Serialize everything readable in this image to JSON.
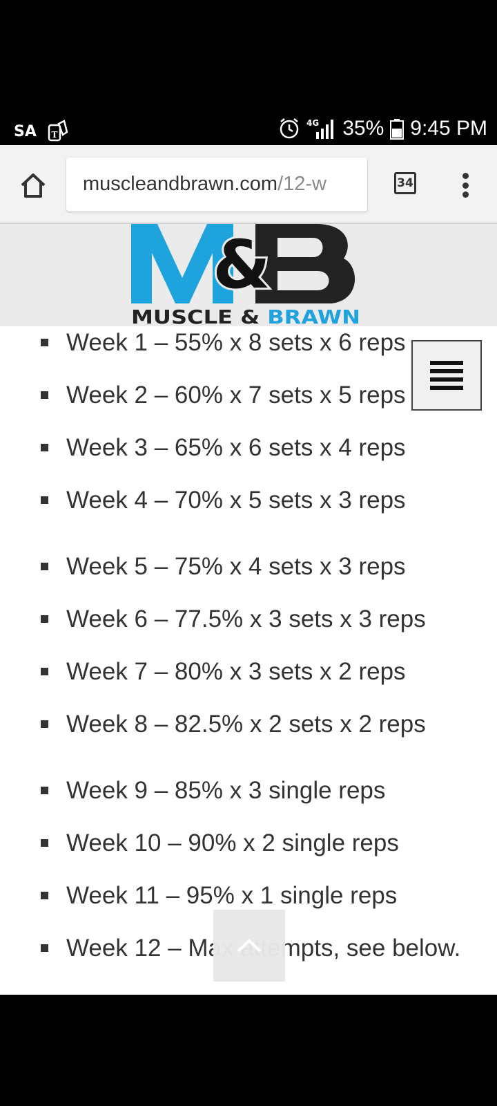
{
  "status_bar": {
    "carrier": "SA",
    "left_icon": "tmobile-notification-icon",
    "alarm_icon": "alarm-icon",
    "network": "4G",
    "signal_icon": "signal-icon",
    "battery_percent": "35%",
    "battery_icon": "battery-icon",
    "time": "9:45 PM"
  },
  "browser": {
    "url_domain": "muscleandbrawn.com",
    "url_path": "/12-w",
    "tab_count": "34",
    "home_icon": "home-icon",
    "menu_icon": "more-vert-icon"
  },
  "site": {
    "logo_mark": "M&B",
    "logo_text_1": "MUSCLE & ",
    "logo_text_2": "BRAWN",
    "colors": {
      "brand_blue": "#1ea3dc",
      "brand_dark": "#222222"
    }
  },
  "weeks": [
    "Week 1 – 55% x 8 sets x 6 reps",
    "Week 2 – 60% x 7 sets x 5 reps",
    "Week 3 – 65% x 6 sets x 4 reps",
    "Week 4 – 70% x 5 sets x 3 reps",
    "Week 5 – 75% x 4 sets x 3 reps",
    "Week 6 – 77.5% x 3 sets x 3 reps",
    "Week 7 – 80% x 3 sets x 2 reps",
    "Week 8 – 82.5% x 2 sets x 2 reps",
    "Week 9 – 85% x 3 single reps",
    "Week 10 – 90% x 2 single reps",
    "Week 11 – 95% x 1 single reps",
    "Week 12 – Max attempts, see below."
  ]
}
